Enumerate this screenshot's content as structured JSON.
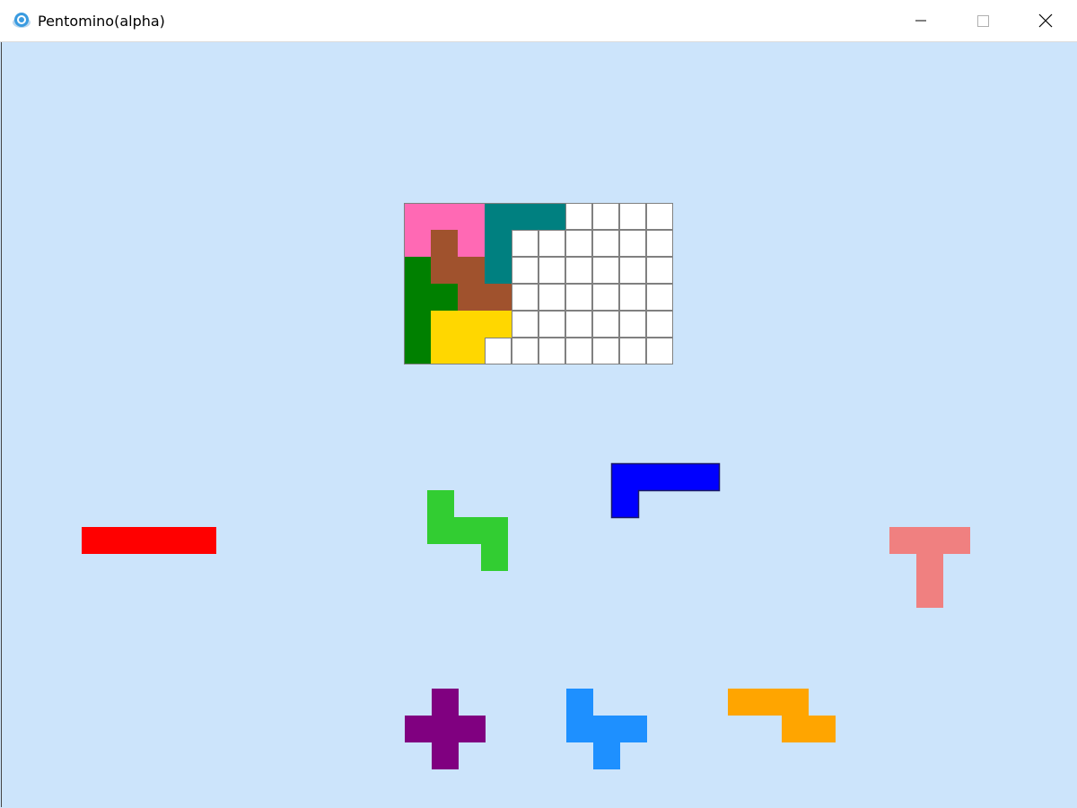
{
  "window": {
    "title": "Pentomino(alpha)",
    "icons": [
      "app-icon",
      "minimize-icon",
      "maximize-icon",
      "close-icon"
    ]
  },
  "board": {
    "cols": 10,
    "rows": 6,
    "empty_color": "#ffffff",
    "grid_color": "#808080",
    "placed_pieces": [
      {
        "name": "P",
        "color": "#ff69b4",
        "cells": [
          [
            0,
            0
          ],
          [
            1,
            0
          ],
          [
            2,
            0
          ],
          [
            0,
            1
          ],
          [
            2,
            1
          ]
        ]
      },
      {
        "name": "V",
        "color": "#008080",
        "cells": [
          [
            3,
            0
          ],
          [
            4,
            0
          ],
          [
            5,
            0
          ],
          [
            3,
            1
          ],
          [
            3,
            2
          ]
        ]
      },
      {
        "name": "W",
        "color": "#a0522d",
        "cells": [
          [
            1,
            1
          ],
          [
            1,
            2
          ],
          [
            2,
            2
          ],
          [
            2,
            3
          ],
          [
            3,
            3
          ]
        ]
      },
      {
        "name": "Y",
        "color": "#008000",
        "cells": [
          [
            0,
            2
          ],
          [
            0,
            3
          ],
          [
            1,
            3
          ],
          [
            0,
            4
          ],
          [
            0,
            5
          ]
        ]
      },
      {
        "name": "L",
        "color": "#ffd700",
        "cells": [
          [
            1,
            4
          ],
          [
            2,
            4
          ],
          [
            3,
            4
          ],
          [
            1,
            5
          ],
          [
            2,
            5
          ]
        ]
      }
    ]
  },
  "tray_pieces": [
    {
      "name": "I",
      "color": "#ff0000",
      "cells": [
        [
          0,
          0
        ],
        [
          1,
          0
        ],
        [
          2,
          0
        ],
        [
          3,
          0
        ],
        [
          4,
          0
        ]
      ]
    },
    {
      "name": "N",
      "color": "#32cd32",
      "cells": [
        [
          0,
          0
        ],
        [
          0,
          1
        ],
        [
          1,
          1
        ],
        [
          2,
          1
        ],
        [
          2,
          2
        ]
      ]
    },
    {
      "name": "V",
      "color": "#0000ff",
      "outlined": true,
      "cells": [
        [
          0,
          0
        ],
        [
          1,
          0
        ],
        [
          2,
          0
        ],
        [
          3,
          0
        ],
        [
          0,
          1
        ]
      ]
    },
    {
      "name": "T",
      "color": "#f08080",
      "cells": [
        [
          0,
          0
        ],
        [
          1,
          0
        ],
        [
          2,
          0
        ],
        [
          1,
          1
        ],
        [
          1,
          2
        ]
      ]
    },
    {
      "name": "X",
      "color": "#800080",
      "cells": [
        [
          1,
          0
        ],
        [
          0,
          1
        ],
        [
          1,
          1
        ],
        [
          2,
          1
        ],
        [
          1,
          2
        ]
      ]
    },
    {
      "name": "F",
      "color": "#1e90ff",
      "cells": [
        [
          0,
          0
        ],
        [
          0,
          1
        ],
        [
          1,
          1
        ],
        [
          2,
          1
        ],
        [
          1,
          2
        ]
      ]
    },
    {
      "name": "Z",
      "color": "#ffa500",
      "cells": [
        [
          0,
          0
        ],
        [
          1,
          0
        ],
        [
          2,
          0
        ],
        [
          2,
          1
        ],
        [
          3,
          1
        ]
      ]
    }
  ]
}
